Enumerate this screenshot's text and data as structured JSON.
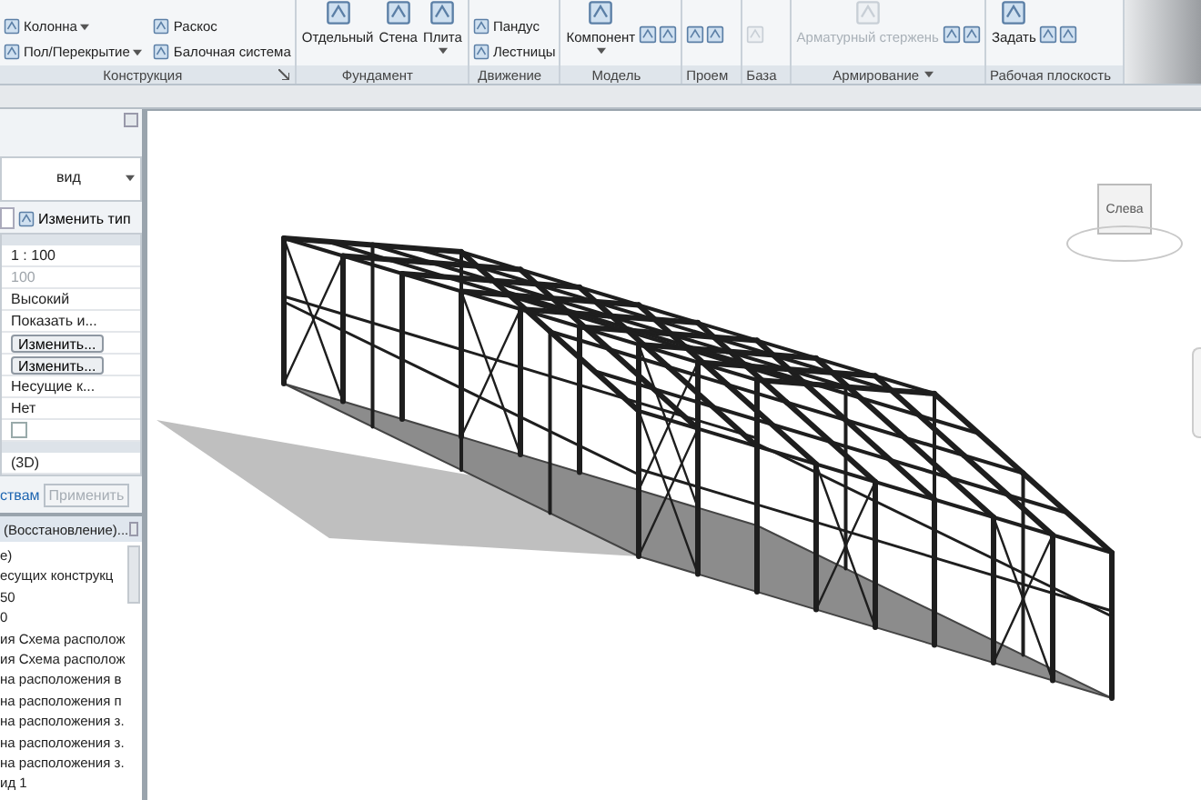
{
  "ribbon": {
    "panels": [
      {
        "label": "Конструкция",
        "launcher": true,
        "tools": [
          {
            "kind": "small",
            "label": "Колонна",
            "dropdown": true
          },
          {
            "kind": "small",
            "label": "Пол/Перекрытие",
            "dropdown": true
          },
          {
            "kind": "small",
            "label": "Раскос",
            "dropdown": false
          },
          {
            "kind": "small",
            "label": "Балочная система",
            "dropdown": false
          }
        ]
      },
      {
        "label": "Фундамент",
        "launcher": false,
        "tools": [
          {
            "kind": "large",
            "label": "Отдельный",
            "dropdown": false,
            "disabled": false
          },
          {
            "kind": "large",
            "label": "Стена",
            "dropdown": false,
            "disabled": false
          },
          {
            "kind": "large",
            "label": "Плита",
            "dropdown": true,
            "disabled": false
          }
        ]
      },
      {
        "label": "Движение",
        "launcher": false,
        "tools": [
          {
            "kind": "small",
            "label": "Пандус",
            "dropdown": false
          },
          {
            "kind": "small",
            "label": "Лестницы",
            "dropdown": false
          }
        ]
      },
      {
        "label": "Модель",
        "launcher": false,
        "tools": [
          {
            "kind": "large",
            "label": "Компонент",
            "dropdown": true,
            "disabled": false
          },
          {
            "kind": "icon",
            "disabled": false
          },
          {
            "kind": "icon",
            "disabled": false
          }
        ]
      },
      {
        "label": "Проем",
        "launcher": false,
        "tools": [
          {
            "kind": "icon",
            "disabled": false
          },
          {
            "kind": "icon",
            "disabled": false
          }
        ]
      },
      {
        "label": "База",
        "launcher": false,
        "tools": [
          {
            "kind": "icon",
            "disabled": true
          }
        ]
      },
      {
        "label": "Армирование",
        "launcher": false,
        "dropdown": true,
        "tools": [
          {
            "kind": "large",
            "label": "Арматурный стержень",
            "dropdown": false,
            "disabled": true
          },
          {
            "kind": "icon",
            "disabled": false
          },
          {
            "kind": "icon",
            "disabled": false
          }
        ]
      },
      {
        "label": "Рабочая плоскость",
        "launcher": false,
        "tools": [
          {
            "kind": "large",
            "label": "Задать",
            "dropdown": false,
            "disabled": false
          },
          {
            "kind": "icon",
            "disabled": false
          },
          {
            "kind": "icon",
            "disabled": false
          }
        ]
      }
    ]
  },
  "properties": {
    "type_selector": "вид",
    "edit_type_button": "Изменить тип",
    "rows": [
      {
        "kind": "text",
        "value": "1 : 100",
        "disabled": false
      },
      {
        "kind": "text",
        "value": "100",
        "disabled": true
      },
      {
        "kind": "text",
        "value": "Высокий",
        "disabled": false
      },
      {
        "kind": "text",
        "value": "Показать и...",
        "disabled": false
      },
      {
        "kind": "button",
        "value": "Изменить..."
      },
      {
        "kind": "button",
        "value": "Изменить..."
      },
      {
        "kind": "text",
        "value": "Несущие к...",
        "disabled": false
      },
      {
        "kind": "text",
        "value": "Нет",
        "disabled": false
      },
      {
        "kind": "checkbox",
        "checked": false
      }
    ],
    "group_rows": [
      {
        "value": "(3D)"
      }
    ],
    "help_link": "ствам",
    "apply_button": {
      "label": "Применить",
      "disabled": true
    }
  },
  "project_browser": {
    "title": "(Восстановление)...",
    "items": [
      "е)",
      "есущих конструкц",
      "50",
      "0",
      "ия Схема располож",
      "ия Схема располож",
      "на расположения в",
      "на расположения п",
      "на расположения з.",
      "на расположения з.",
      "на расположения з.",
      "ид 1"
    ]
  },
  "view_cube": {
    "face_label": "Слева"
  }
}
